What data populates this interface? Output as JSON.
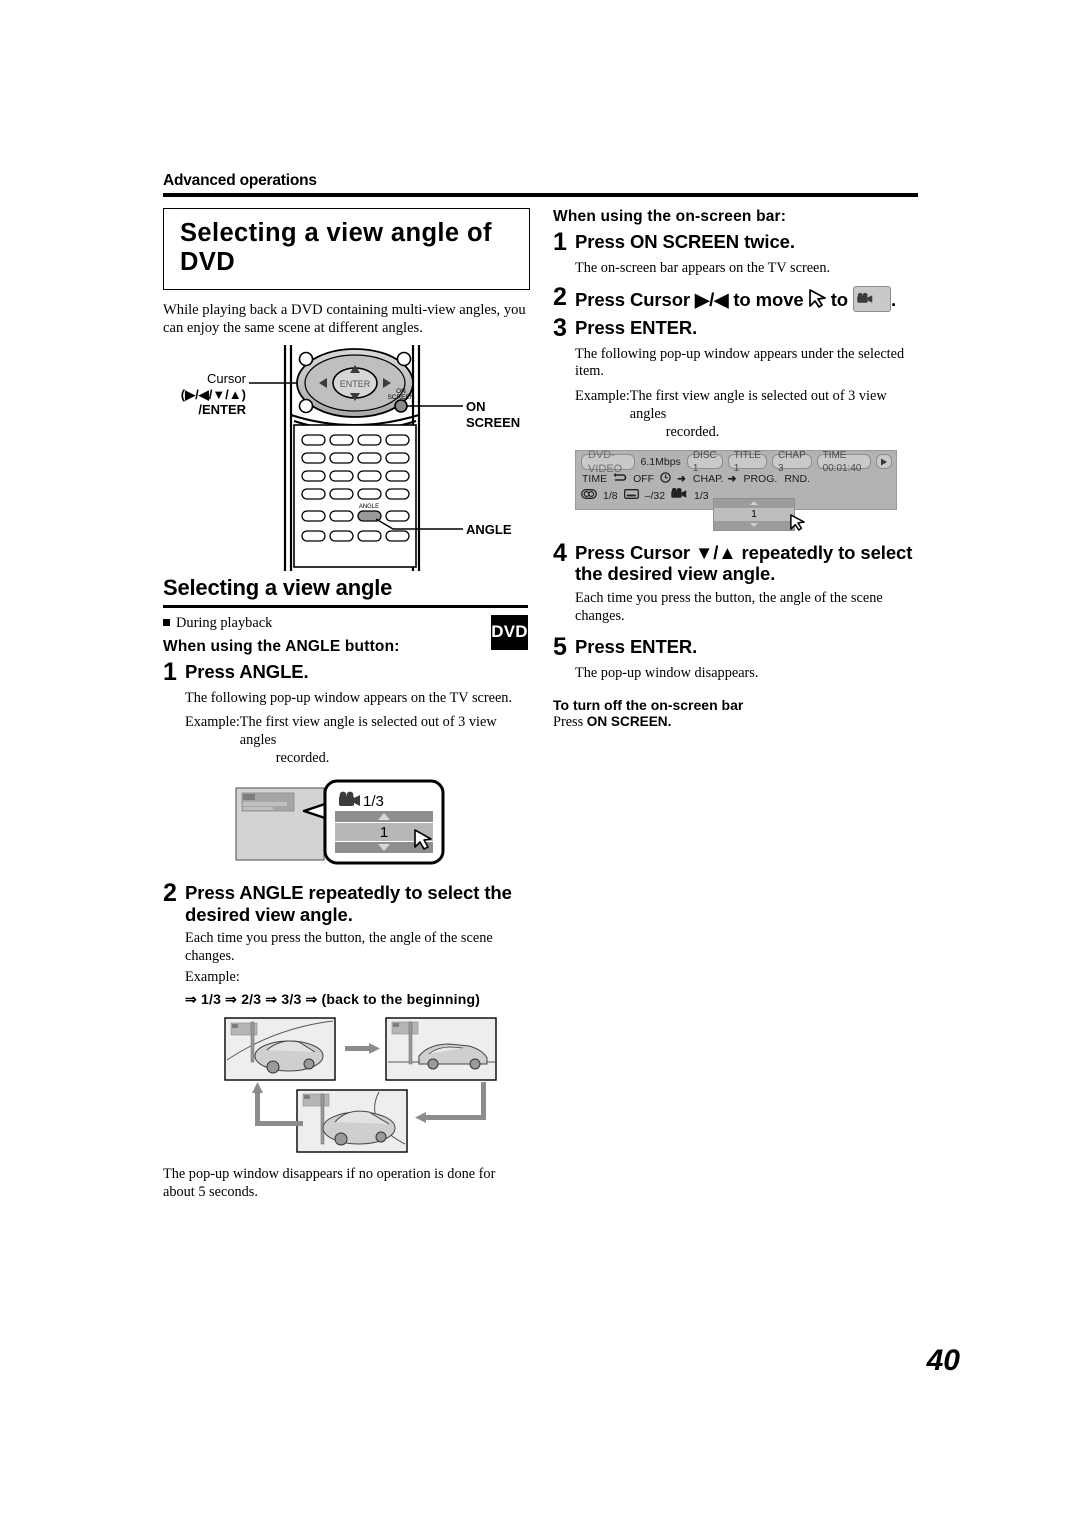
{
  "page": {
    "running_head": "Advanced operations",
    "page_number": "40"
  },
  "left_column": {
    "title": "Selecting a view angle of DVD",
    "intro": "While playing back a DVD containing multi-view angles, you can enjoy the same scene at different angles.",
    "remote_labels": {
      "cursor_line1": "Cursor",
      "cursor_line2": "(▶/◀/▼/▲)",
      "cursor_line3": "/ENTER",
      "enter_button": "ENTER",
      "on_screen_small": "ON SCREEN",
      "on_screen": "ON SCREEN",
      "angle_small": "ANGLE",
      "angle": "ANGLE"
    },
    "section_heading": "Selecting a view angle",
    "during_playback": "During playback",
    "disc_badge": "DVD",
    "subhead": "When using the ANGLE button:",
    "step1": {
      "num": "1",
      "title": "Press ANGLE.",
      "body": "The following pop-up window appears on the TV screen.",
      "example_label": "Example:",
      "example_text": "The first view angle is selected out of 3 view angles",
      "example_text2": "recorded."
    },
    "popup": {
      "angle_value": "1/3",
      "selected": "1"
    },
    "step2": {
      "num": "2",
      "title": "Press ANGLE repeatedly to select the desired view angle.",
      "body": "Each time you press the button, the angle of the scene changes.",
      "example_label": "Example:",
      "sequence": "⇒ 1/3 ⇒ 2/3 ⇒ 3/3 ⇒ (back to the beginning)"
    },
    "footnote": "The pop-up window disappears if no operation is done for about 5 seconds."
  },
  "right_column": {
    "subhead": "When using the on-screen bar:",
    "step1": {
      "num": "1",
      "title": "Press ON SCREEN twice.",
      "body": "The on-screen bar appears on the TV screen."
    },
    "step2": {
      "num": "2",
      "title_a": "Press Cursor ▶/◀ to move",
      "title_b": "to",
      "title_c": "."
    },
    "step3": {
      "num": "3",
      "title": "Press ENTER.",
      "body": "The following pop-up window appears under the selected item.",
      "example_label": "Example:",
      "example_text": "The first view angle is selected out of 3 view angles",
      "example_text2": "recorded."
    },
    "on_screen_bar": {
      "row1": {
        "format": "DVD-VIDEO",
        "bitrate": "6.1Mbps",
        "disc": "DISC 1",
        "title": "TITLE  1",
        "chapter": "CHAP  3",
        "time": "TIME 00:01:40",
        "play_icon": "play-icon"
      },
      "row2": {
        "time": "TIME",
        "repeat_icon": "repeat-icon",
        "repeat_value": "OFF",
        "clock_icon": "clock-icon",
        "clock_arrow": "➜",
        "chapter": "CHAP.",
        "chapter_arrow": "➜",
        "program": "PROG.",
        "random": "RND."
      },
      "row3": {
        "audio_icon": "audio-icon",
        "audio_value": "1/8",
        "subtitle_icon": "subtitle-icon",
        "subtitle_value": "–/32",
        "angle_icon": "angle-camera-icon",
        "angle_value": "1/3"
      },
      "popup_value": "1"
    },
    "step4": {
      "num": "4",
      "title": "Press Cursor ▼/▲ repeatedly to select the desired view angle.",
      "body": "Each time you press the button, the angle of the scene changes."
    },
    "step5": {
      "num": "5",
      "title": "Press ENTER.",
      "body": "The pop-up window disappears."
    },
    "turn_off": {
      "heading": "To turn off the on-screen bar",
      "text_a": "Press",
      "text_b": "ON SCREEN."
    }
  }
}
